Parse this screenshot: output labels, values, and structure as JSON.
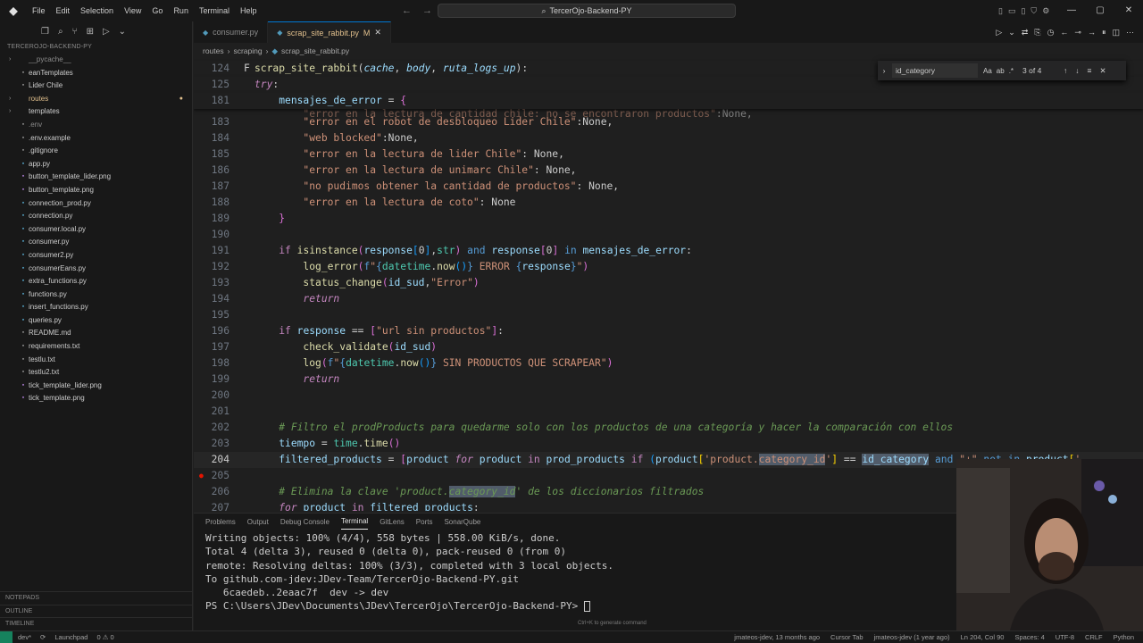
{
  "titlebar": {
    "menu": [
      "File",
      "Edit",
      "Selection",
      "View",
      "Go",
      "Run",
      "Terminal",
      "Help"
    ],
    "command_center": "TercerOjo-Backend-PY"
  },
  "explorer": {
    "root": "TERCEROJO-BACKEND-PY",
    "items": [
      {
        "label": "__pycache__",
        "kind": "folder",
        "style": "dim"
      },
      {
        "label": "eanTemplates",
        "kind": "file",
        "style": "normal"
      },
      {
        "label": "Lider Chile",
        "kind": "file",
        "style": "normal"
      },
      {
        "label": "routes",
        "kind": "folder",
        "style": "mod"
      },
      {
        "label": "templates",
        "kind": "folder",
        "style": "normal"
      },
      {
        "label": ".env",
        "kind": "file",
        "style": "dim"
      },
      {
        "label": ".env.example",
        "kind": "file",
        "style": "normal"
      },
      {
        "label": ".gitignore",
        "kind": "file",
        "style": "normal"
      },
      {
        "label": "app.py",
        "kind": "file",
        "style": "normal"
      },
      {
        "label": "button_template_lider.png",
        "kind": "file",
        "style": "normal"
      },
      {
        "label": "button_template.png",
        "kind": "file",
        "style": "normal"
      },
      {
        "label": "connection_prod.py",
        "kind": "file",
        "style": "normal"
      },
      {
        "label": "connection.py",
        "kind": "file",
        "style": "normal"
      },
      {
        "label": "consumer.local.py",
        "kind": "file",
        "style": "normal"
      },
      {
        "label": "consumer.py",
        "kind": "file",
        "style": "normal"
      },
      {
        "label": "consumer2.py",
        "kind": "file",
        "style": "normal"
      },
      {
        "label": "consumerEans.py",
        "kind": "file",
        "style": "normal"
      },
      {
        "label": "extra_functions.py",
        "kind": "file",
        "style": "normal"
      },
      {
        "label": "functions.py",
        "kind": "file",
        "style": "normal"
      },
      {
        "label": "insert_functions.py",
        "kind": "file",
        "style": "normal"
      },
      {
        "label": "queries.py",
        "kind": "file",
        "style": "normal"
      },
      {
        "label": "README.md",
        "kind": "file",
        "style": "normal"
      },
      {
        "label": "requirements.txt",
        "kind": "file",
        "style": "normal"
      },
      {
        "label": "testlu.txt",
        "kind": "file",
        "style": "normal"
      },
      {
        "label": "testlu2.txt",
        "kind": "file",
        "style": "normal"
      },
      {
        "label": "tick_template_lider.png",
        "kind": "file",
        "style": "normal"
      },
      {
        "label": "tick_template.png",
        "kind": "file",
        "style": "normal"
      }
    ],
    "bottom_sections": [
      "NOTEPADS",
      "OUTLINE",
      "TIMELINE"
    ]
  },
  "tabs": [
    {
      "label": "consumer.py",
      "active": false,
      "badge": ""
    },
    {
      "label": "scrap_site_rabbit.py",
      "active": true,
      "badge": "M"
    }
  ],
  "breadcrumb": [
    "routes",
    "scraping",
    "scrap_site_rabbit.py"
  ],
  "find": {
    "query": "id_category",
    "count": "3 of 4",
    "opts": [
      "Aa",
      "ab",
      ".*"
    ]
  },
  "panel": {
    "tabs": [
      "Problems",
      "Output",
      "Debug Console",
      "Terminal",
      "GitLens",
      "Ports",
      "SonarQube"
    ],
    "active_tab": "Terminal",
    "terminal_lines": [
      "Writing objects: 100% (4/4), 558 bytes | 558.00 KiB/s, done.",
      "Total 4 (delta 3), reused 0 (delta 0), pack-reused 0 (from 0)",
      "remote: Resolving deltas: 100% (3/3), completed with 3 local objects.",
      "To github.com-jdev:JDev-Team/TercerOjo-Backend-PY.git",
      "   6caedeb..2eaac7f  dev -> dev",
      "PS C:\\Users\\JDev\\Documents\\JDev\\TercerOjo\\TercerOjo-Backend-PY> "
    ],
    "hint": "Ctrl+K to generate command"
  },
  "statusbar": {
    "left": [
      "dev*",
      "Launchpad",
      "0 ⚠ 0"
    ],
    "right": [
      "jmateos-jdev, 13 months ago",
      "Cursor Tab",
      "jmateos-jdev (1 year ago)",
      "Ln 204, Col 90",
      "Spaces: 4",
      "UTF-8",
      "CRLF",
      "Python"
    ]
  },
  "colors": {
    "accent": "#0078d4",
    "modified": "#e2c08d",
    "keyword": "#c586c0",
    "function": "#dcdcaa",
    "string": "#ce9178",
    "comment": "#6a9955"
  }
}
